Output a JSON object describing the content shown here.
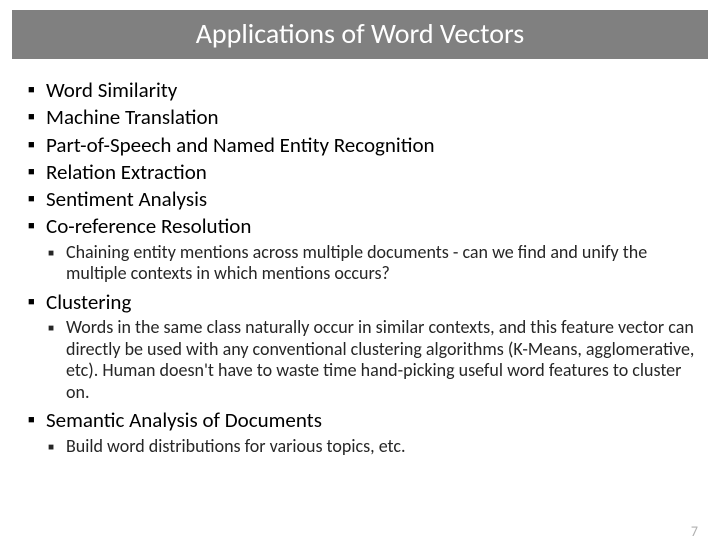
{
  "title": "Applications of Word Vectors",
  "items": {
    "b1": "Word Similarity",
    "b2": "Machine Translation",
    "b3": "Part-of-Speech and Named Entity Recognition",
    "b4": "Relation Extraction",
    "b5": "Sentiment Analysis",
    "b6": "Co-reference Resolution",
    "b6_sub": "Chaining entity mentions across multiple documents - can we find and unify the multiple contexts in which mentions occurs?",
    "b7": "Clustering",
    "b7_sub": "Words in the same class naturally occur in similar contexts, and this feature vector can directly be used with any conventional clustering algorithms (K-Means, agglomerative, etc). Human doesn't have to waste time hand-picking useful word features to cluster on.",
    "b8": "Semantic Analysis of Documents",
    "b8_sub": "Build word distributions for various topics, etc."
  },
  "page_number": "7"
}
